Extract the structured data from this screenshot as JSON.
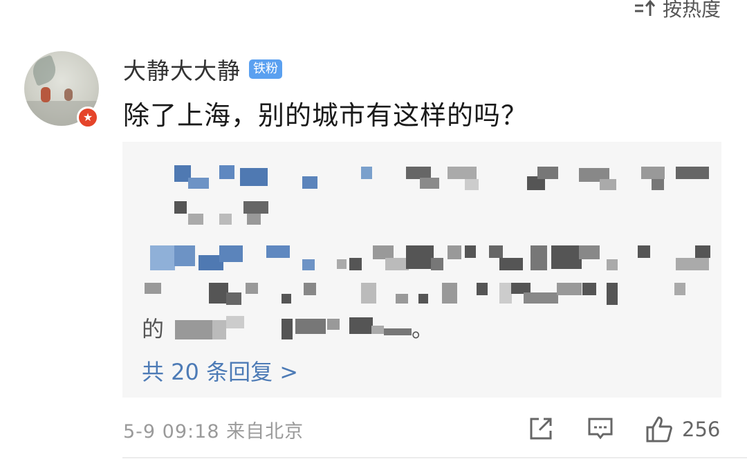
{
  "sort": {
    "label": "按热度",
    "icon": "sort-icon"
  },
  "comment": {
    "username": "大静大大静",
    "badge": "铁粉",
    "text": "除了上海，别的城市有这样的吗？",
    "avatar_icon": "user-avatar",
    "avatar_badge_icon": "star-badge-icon"
  },
  "reply_preview": {
    "reply_prefix": "的",
    "more_replies_label": "共 20 条回复 >"
  },
  "footer": {
    "meta": "5-9 09:18  来自北京",
    "like_count": "256",
    "icons": [
      "share-icon",
      "comment-icon",
      "like-icon"
    ]
  },
  "colors": {
    "link": "#4d7bb6",
    "badge": "#5aa0f0",
    "star_badge": "#e5442a",
    "reply_bg": "#f6f6f6"
  }
}
